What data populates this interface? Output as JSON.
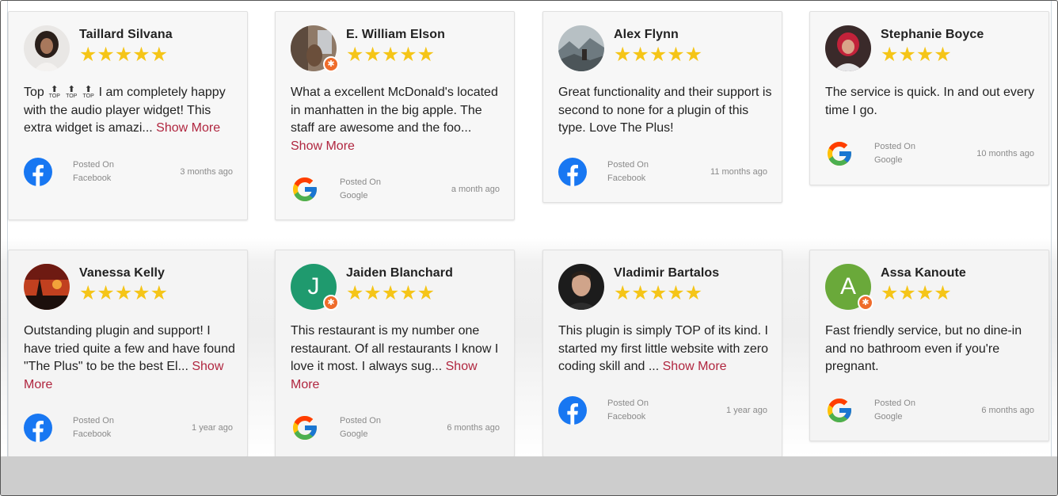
{
  "colors": {
    "star": "#f5c518",
    "show_more": "#b0263f",
    "facebook": "#1877f2"
  },
  "reviews": [
    {
      "name": "Taillard Silvana",
      "stars": "★★★★★",
      "text": "I am completely happy with the audio player widget! This extra widget is amazi... ",
      "text_prefix": "Top",
      "top_icons": [
        "TOP",
        "TOP",
        "TOP"
      ],
      "show_more": "Show More",
      "posted_label": "Posted On",
      "source": "Facebook",
      "ago": "3 months ago",
      "avatar_icon": "person-photo"
    },
    {
      "name": "E. William Elson",
      "stars": "★★★★★",
      "text": "What a excellent McDonald's located in manhatten in the big apple. The staff are awesome and the foo... ",
      "show_more": "Show More",
      "posted_label": "Posted On",
      "source": "Google",
      "ago": "a month ago",
      "avatar_icon": "person-photo"
    },
    {
      "name": "Alex Flynn",
      "stars": "★★★★★",
      "text": "Great functionality and their support is second to none for a plugin of this type. Love The Plus!",
      "show_more": "",
      "posted_label": "Posted On",
      "source": "Facebook",
      "ago": "11 months ago",
      "avatar_icon": "landscape-photo"
    },
    {
      "name": "Stephanie Boyce",
      "stars": "★★★★",
      "text": "The service is quick. In and out every time I go.",
      "show_more": "",
      "posted_label": "Posted On",
      "source": "Google",
      "ago": "10 months ago",
      "avatar_icon": "person-photo"
    },
    {
      "name": "Vanessa Kelly",
      "stars": "★★★★★",
      "text": "Outstanding plugin and support! I have tried quite a few and have found \"The Plus\" to be the best El... ",
      "show_more": "Show More",
      "posted_label": "Posted On",
      "source": "Facebook",
      "ago": "1 year ago",
      "avatar_icon": "sunset-photo"
    },
    {
      "name": "Jaiden Blanchard",
      "stars": "★★★★★",
      "text": "This restaurant is my number one restaurant. Of all restaurants I know I love it most. I always sug... ",
      "show_more": "Show More",
      "posted_label": "Posted On",
      "source": "Google",
      "ago": "6 months ago",
      "avatar_letter": "J",
      "avatar_color": "#1f9a6e"
    },
    {
      "name": "Vladimir Bartalos",
      "stars": "★★★★★",
      "text": "This plugin is simply TOP of its kind. I started my first little website with zero coding skill and ... ",
      "show_more": "Show More",
      "posted_label": "Posted On",
      "source": "Facebook",
      "ago": "1 year ago",
      "avatar_icon": "person-photo"
    },
    {
      "name": "Assa Kanoute",
      "stars": "★★★★",
      "text": "Fast friendly service, but no dine-in and no bathroom even if you're pregnant.",
      "show_more": "",
      "posted_label": "Posted On",
      "source": "Google",
      "ago": "6 months ago",
      "avatar_letter": "A",
      "avatar_color": "#6aa93a"
    }
  ]
}
